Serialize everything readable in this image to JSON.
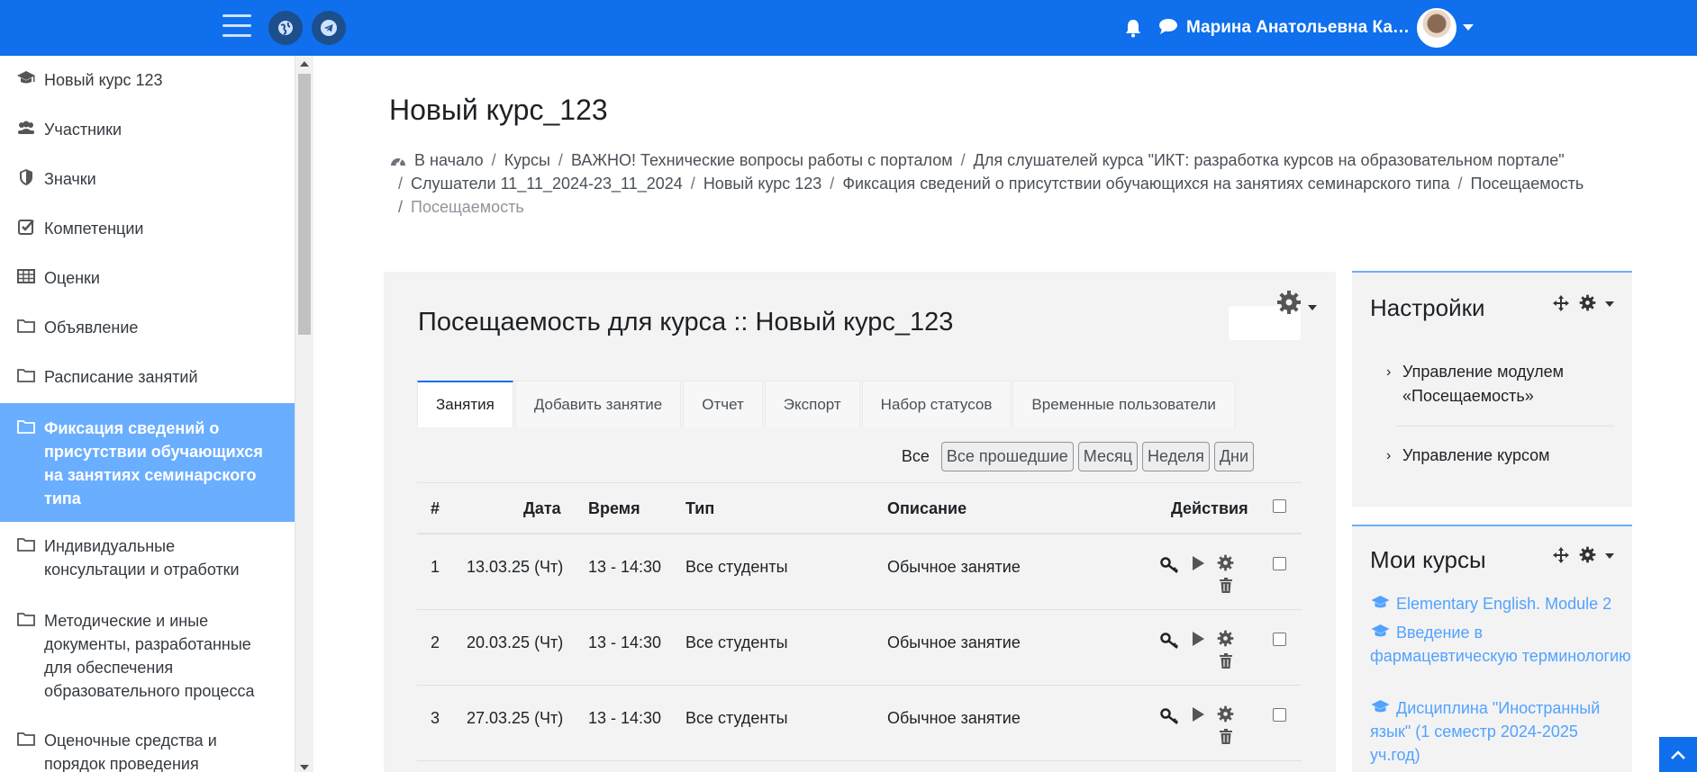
{
  "navbar": {
    "user_name": "Марина Анатольевна Калин…",
    "menu_icon": "hamburger-icon",
    "globe_icon": "globe-icon",
    "telegram_icon": "telegram-icon",
    "bell_icon": "bell-icon",
    "chat_icon": "chat-icon"
  },
  "drawer": {
    "items": [
      {
        "label": "Новый курс 123",
        "icon": "graduation-cap-icon"
      },
      {
        "label": "Участники",
        "icon": "users-icon"
      },
      {
        "label": "Значки",
        "icon": "shield-icon"
      },
      {
        "label": "Компетенции",
        "icon": "checkbox-icon"
      },
      {
        "label": "Оценки",
        "icon": "table-icon"
      },
      {
        "label": "Объявление",
        "icon": "folder-icon"
      },
      {
        "label": "Расписание занятий",
        "icon": "folder-icon"
      },
      {
        "label": "Фиксация сведений о присутствии обучающихся на занятиях семинарского типа",
        "icon": "folder-icon"
      },
      {
        "label": "Индивидуальные консультации и отработки",
        "icon": "folder-icon"
      },
      {
        "label": "Методические и иные документы, разработанные для обеспечения образовательного процесса",
        "icon": "folder-icon"
      },
      {
        "label": "Оценочные средства и порядок проведения",
        "icon": "folder-icon"
      }
    ]
  },
  "page": {
    "title": "Новый курс_123",
    "breadcrumb": [
      "В начало",
      "Курсы",
      "ВАЖНО! Технические вопросы работы с порталом",
      "Для слушателей курса \"ИКТ: разработка курсов на образовательном портале\"",
      "Слушатели 11_11_2024-23_11_2024",
      "Новый курс 123",
      "Фиксация сведений о присутствии обучающихся на занятиях семинарского типа",
      "Посещаемость",
      "Посещаемость"
    ]
  },
  "attendance": {
    "title": "Посещаемость для курса :: Новый курс_123",
    "tabs": [
      "Занятия",
      "Добавить занятие",
      "Отчет",
      "Экспорт",
      "Набор статусов",
      "Временные пользователи"
    ],
    "filter_all": "Все",
    "filters": [
      "Все прошедшие",
      "Месяц",
      "Неделя",
      "Дни"
    ],
    "columns": {
      "num": "#",
      "date": "Дата",
      "time": "Время",
      "type": "Тип",
      "desc": "Описание",
      "actions": "Действия"
    },
    "rows": [
      {
        "num": "1",
        "date": "13.03.25 (Чт)",
        "time": "13 - 14:30",
        "type": "Все студенты",
        "desc": "Обычное занятие"
      },
      {
        "num": "2",
        "date": "20.03.25 (Чт)",
        "time": "13 - 14:30",
        "type": "Все студенты",
        "desc": "Обычное занятие"
      },
      {
        "num": "3",
        "date": "27.03.25 (Чт)",
        "time": "13 - 14:30",
        "type": "Все студенты",
        "desc": "Обычное занятие"
      }
    ]
  },
  "settings_block": {
    "title": "Настройки",
    "items": [
      "Управление модулем «Посещаемость»",
      "Управление курсом"
    ]
  },
  "courses_block": {
    "title": "Мои курсы",
    "items": [
      "Elementary English. Module 2",
      "Введение в фармацевтическую терминологию",
      "Дисциплина \"Иностранный язык\" (1 семестр 2024-2025 уч.год)"
    ]
  },
  "colors": {
    "navbar": "#0f6fec",
    "active_nav": "#6aaeff",
    "link": "#52a2ff"
  }
}
